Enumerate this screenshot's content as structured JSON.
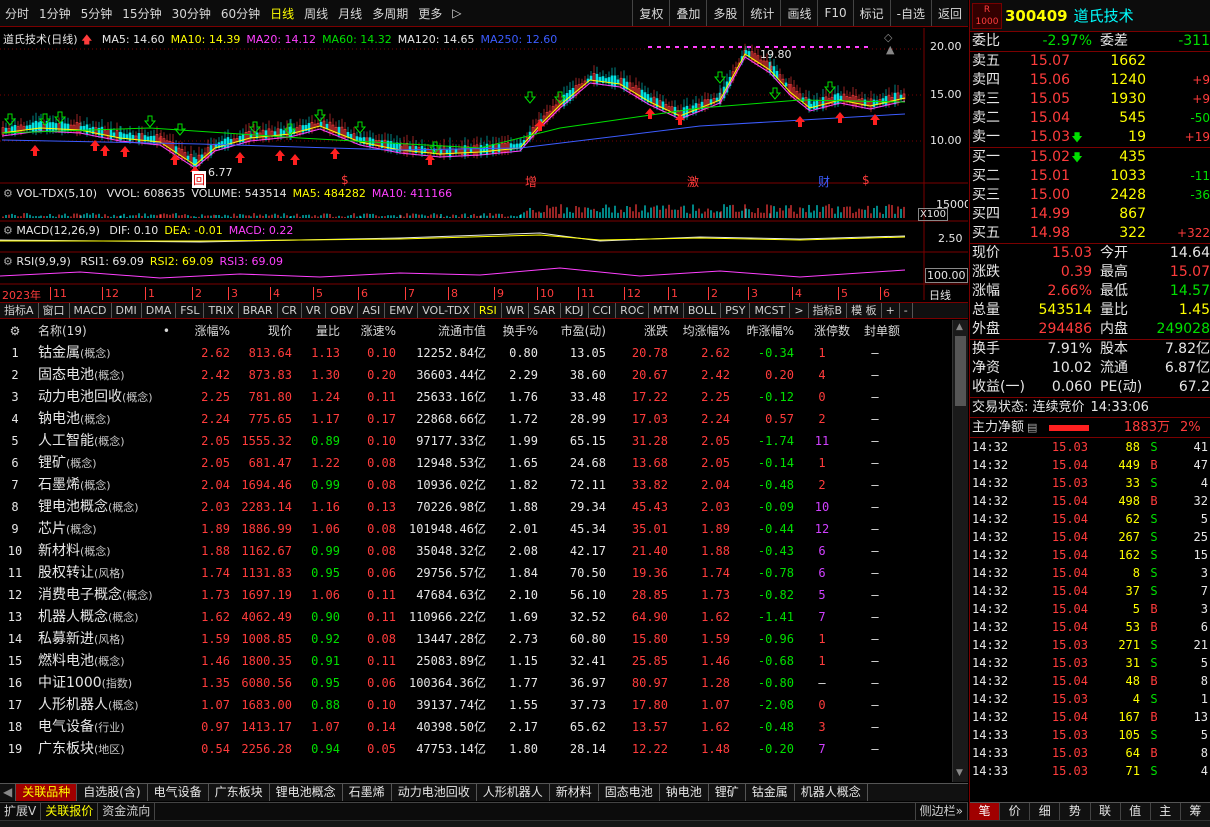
{
  "toolbar": {
    "periods": [
      "分时",
      "1分钟",
      "5分钟",
      "15分钟",
      "30分钟",
      "60分钟",
      "日线",
      "周线",
      "月线",
      "多周期",
      "更多"
    ],
    "active_period": "日线",
    "more_suffix": "▷",
    "right_buttons": [
      "复权",
      "叠加",
      "多股",
      "统计",
      "画线",
      "F10",
      "标记",
      "-自选",
      "返回"
    ]
  },
  "chart": {
    "title": "道氏技术(日线)",
    "ma_labels": [
      {
        "text": "MA5: 14.60",
        "color": "#e6e6e6"
      },
      {
        "text": "MA10: 14.39",
        "color": "#ffff00"
      },
      {
        "text": "MA20: 14.12",
        "color": "#ff40ff"
      },
      {
        "text": "MA60: 14.32",
        "color": "#00e000"
      },
      {
        "text": "MA120: 14.65",
        "color": "#e6e6e6"
      },
      {
        "text": "MA250: 12.60",
        "color": "#3c5cff"
      }
    ],
    "price_axis": [
      "20.00",
      "15.00",
      "10.00"
    ],
    "high_label": "19.80",
    "low_label": "6.77",
    "markers": [
      {
        "text": "回",
        "color": "#ff3c3c"
      },
      {
        "text": "$",
        "color": "#ff3c3c"
      },
      {
        "text": "增",
        "color": "#ff3c3c"
      },
      {
        "text": "激",
        "color": "#ff3c3c"
      },
      {
        "text": "财",
        "color": "#3c5cff"
      },
      {
        "text": "$",
        "color": "#ff3c3c"
      }
    ],
    "vol": {
      "label": "VOL-TDX(5,10)",
      "items": [
        {
          "text": "VVOL: 608635",
          "color": "#e6e6e6"
        },
        {
          "text": "VOLUME: 543514",
          "color": "#e6e6e6"
        },
        {
          "text": "MA5: 484282",
          "color": "#ffff00"
        },
        {
          "text": "MA10: 411166",
          "color": "#ff40ff"
        }
      ],
      "axis": "15000",
      "unit": "X100"
    },
    "macd": {
      "label": "MACD(12,26,9)",
      "items": [
        {
          "text": "DIF: 0.10",
          "color": "#e6e6e6"
        },
        {
          "text": "DEA: -0.01",
          "color": "#ffff00"
        },
        {
          "text": "MACD: 0.22",
          "color": "#ff40ff"
        }
      ],
      "axis": "2.50"
    },
    "rsi": {
      "label": "RSI(9,9,9)",
      "items": [
        {
          "text": "RSI1: 69.09",
          "color": "#e6e6e6"
        },
        {
          "text": "RSI2: 69.09",
          "color": "#ffff00"
        },
        {
          "text": "RSI3: 69.09",
          "color": "#ff40ff"
        }
      ],
      "axis": "100.00"
    },
    "date_axis": {
      "year": "2023年",
      "months": [
        "11",
        "12",
        "1",
        "2",
        "3",
        "4",
        "5",
        "6",
        "7",
        "8",
        "9",
        "10",
        "11",
        "12",
        "1",
        "2",
        "3",
        "4",
        "5",
        "6"
      ],
      "right_label": "日线"
    }
  },
  "indicator_tabs": [
    "指标A",
    "窗口",
    "MACD",
    "DMI",
    "DMA",
    "FSL",
    "TRIX",
    "BRAR",
    "CR",
    "VR",
    "OBV",
    "ASI",
    "EMV",
    "VOL-TDX",
    "RSI",
    "WR",
    "SAR",
    "KDJ",
    "CCI",
    "ROC",
    "MTM",
    "BOLL",
    "PSY",
    "MCST",
    ">",
    "指标B",
    "模 板",
    "+",
    "-"
  ],
  "indicator_active": "RSI",
  "table": {
    "headers": [
      "",
      "名称(19)",
      "•",
      "涨幅%",
      "现价",
      "量比",
      "涨速%",
      "流通市值",
      "换手%",
      "市盈(动)",
      "涨跌",
      "均涨幅%",
      "昨涨幅%",
      "涨停数",
      "封单额"
    ],
    "rows": [
      {
        "idx": "1",
        "name": "钴金属",
        "tag": "(概念)",
        "chg": "2.62",
        "price": "813.64",
        "vr": "1.13",
        "spd": "0.10",
        "mcap": "12252.84亿",
        "turn": "0.80",
        "pe": "13.05",
        "diff": "20.78",
        "avg": "2.62",
        "prev": "-0.34",
        "limit": "1",
        "seal": "–"
      },
      {
        "idx": "2",
        "name": "固态电池",
        "tag": "(概念)",
        "chg": "2.42",
        "price": "873.83",
        "vr": "1.30",
        "spd": "0.20",
        "mcap": "36603.44亿",
        "turn": "2.29",
        "pe": "38.60",
        "diff": "20.67",
        "avg": "2.42",
        "prev": "0.20",
        "limit": "4",
        "seal": "–"
      },
      {
        "idx": "3",
        "name": "动力电池回收",
        "tag": "(概念)",
        "chg": "2.25",
        "price": "781.80",
        "vr": "1.24",
        "spd": "0.11",
        "mcap": "25633.16亿",
        "turn": "1.76",
        "pe": "33.48",
        "diff": "17.22",
        "avg": "2.25",
        "prev": "-0.12",
        "limit": "0",
        "seal": "–"
      },
      {
        "idx": "4",
        "name": "钠电池",
        "tag": "(概念)",
        "chg": "2.24",
        "price": "775.65",
        "vr": "1.17",
        "spd": "0.17",
        "mcap": "22868.66亿",
        "turn": "1.72",
        "pe": "28.99",
        "diff": "17.03",
        "avg": "2.24",
        "prev": "0.57",
        "limit": "2",
        "seal": "–"
      },
      {
        "idx": "5",
        "name": "人工智能",
        "tag": "(概念)",
        "chg": "2.05",
        "price": "1555.32",
        "vr": "0.89",
        "spd": "0.10",
        "mcap": "97177.33亿",
        "turn": "1.99",
        "pe": "65.15",
        "diff": "31.28",
        "avg": "2.05",
        "prev": "-1.74",
        "limit": "11",
        "seal": "–"
      },
      {
        "idx": "6",
        "name": "锂矿",
        "tag": "(概念)",
        "chg": "2.05",
        "price": "681.47",
        "vr": "1.22",
        "spd": "0.08",
        "mcap": "12948.53亿",
        "turn": "1.65",
        "pe": "24.68",
        "diff": "13.68",
        "avg": "2.05",
        "prev": "-0.14",
        "limit": "1",
        "seal": "–"
      },
      {
        "idx": "7",
        "name": "石墨烯",
        "tag": "(概念)",
        "chg": "2.04",
        "price": "1694.46",
        "vr": "0.99",
        "spd": "0.08",
        "mcap": "10936.02亿",
        "turn": "1.82",
        "pe": "72.11",
        "diff": "33.82",
        "avg": "2.04",
        "prev": "-0.48",
        "limit": "2",
        "seal": "–"
      },
      {
        "idx": "8",
        "name": "锂电池概念",
        "tag": "(概念)",
        "chg": "2.03",
        "price": "2283.14",
        "vr": "1.16",
        "spd": "0.13",
        "mcap": "70226.98亿",
        "turn": "1.88",
        "pe": "29.34",
        "diff": "45.43",
        "avg": "2.03",
        "prev": "-0.09",
        "limit": "10",
        "seal": "–"
      },
      {
        "idx": "9",
        "name": "芯片",
        "tag": "(概念)",
        "chg": "1.89",
        "price": "1886.99",
        "vr": "1.06",
        "spd": "0.08",
        "mcap": "101948.46亿",
        "turn": "2.01",
        "pe": "45.34",
        "diff": "35.01",
        "avg": "1.89",
        "prev": "-0.44",
        "limit": "12",
        "seal": "–"
      },
      {
        "idx": "10",
        "name": "新材料",
        "tag": "(概念)",
        "chg": "1.88",
        "price": "1162.67",
        "vr": "0.99",
        "spd": "0.08",
        "mcap": "35048.32亿",
        "turn": "2.08",
        "pe": "42.17",
        "diff": "21.40",
        "avg": "1.88",
        "prev": "-0.43",
        "limit": "6",
        "seal": "–"
      },
      {
        "idx": "11",
        "name": "股权转让",
        "tag": "(风格)",
        "chg": "1.74",
        "price": "1131.83",
        "vr": "0.95",
        "spd": "0.06",
        "mcap": "29756.57亿",
        "turn": "1.84",
        "pe": "70.50",
        "diff": "19.36",
        "avg": "1.74",
        "prev": "-0.78",
        "limit": "6",
        "seal": "–"
      },
      {
        "idx": "12",
        "name": "消费电子概念",
        "tag": "(概念)",
        "chg": "1.73",
        "price": "1697.19",
        "vr": "1.06",
        "spd": "0.11",
        "mcap": "47684.63亿",
        "turn": "2.10",
        "pe": "56.10",
        "diff": "28.85",
        "avg": "1.73",
        "prev": "-0.82",
        "limit": "5",
        "seal": "–"
      },
      {
        "idx": "13",
        "name": "机器人概念",
        "tag": "(概念)",
        "chg": "1.62",
        "price": "4062.49",
        "vr": "0.90",
        "spd": "0.11",
        "mcap": "110966.22亿",
        "turn": "1.69",
        "pe": "32.52",
        "diff": "64.90",
        "avg": "1.62",
        "prev": "-1.41",
        "limit": "7",
        "seal": "–"
      },
      {
        "idx": "14",
        "name": "私募新进",
        "tag": "(风格)",
        "chg": "1.59",
        "price": "1008.85",
        "vr": "0.92",
        "spd": "0.08",
        "mcap": "13447.28亿",
        "turn": "2.73",
        "pe": "60.80",
        "diff": "15.80",
        "avg": "1.59",
        "prev": "-0.96",
        "limit": "1",
        "seal": "–"
      },
      {
        "idx": "15",
        "name": "燃料电池",
        "tag": "(概念)",
        "chg": "1.46",
        "price": "1800.35",
        "vr": "0.91",
        "spd": "0.11",
        "mcap": "25083.89亿",
        "turn": "1.15",
        "pe": "32.41",
        "diff": "25.85",
        "avg": "1.46",
        "prev": "-0.68",
        "limit": "1",
        "seal": "–"
      },
      {
        "idx": "16",
        "name": "中证1000",
        "tag": "(指数)",
        "chg": "1.35",
        "price": "6080.56",
        "vr": "0.95",
        "spd": "0.06",
        "mcap": "100364.36亿",
        "turn": "1.77",
        "pe": "36.97",
        "diff": "80.97",
        "avg": "1.28",
        "prev": "-0.80",
        "limit": "–",
        "seal": "–"
      },
      {
        "idx": "17",
        "name": "人形机器人",
        "tag": "(概念)",
        "chg": "1.07",
        "price": "1683.00",
        "vr": "0.88",
        "spd": "0.10",
        "mcap": "39137.74亿",
        "turn": "1.55",
        "pe": "37.73",
        "diff": "17.80",
        "avg": "1.07",
        "prev": "-2.08",
        "limit": "0",
        "seal": "–"
      },
      {
        "idx": "18",
        "name": "电气设备",
        "tag": "(行业)",
        "chg": "0.97",
        "price": "1413.17",
        "vr": "1.07",
        "spd": "0.14",
        "mcap": "40398.50亿",
        "turn": "2.17",
        "pe": "65.62",
        "diff": "13.57",
        "avg": "1.62",
        "prev": "-0.48",
        "limit": "3",
        "seal": "–"
      },
      {
        "idx": "19",
        "name": "广东板块",
        "tag": "(地区)",
        "chg": "0.54",
        "price": "2256.28",
        "vr": "0.94",
        "spd": "0.05",
        "mcap": "47753.14亿",
        "turn": "1.80",
        "pe": "28.14",
        "diff": "12.22",
        "avg": "1.48",
        "prev": "-0.20",
        "limit": "7",
        "seal": "–"
      }
    ]
  },
  "bottom_tabs": [
    "关联品种",
    "自选股(含)",
    "电气设备",
    "广东板块",
    "锂电池概念",
    "石墨烯",
    "动力电池回收",
    "人形机器人",
    "新材料",
    "固态电池",
    "钠电池",
    "锂矿",
    "钴金属",
    "机器人概念"
  ],
  "bottom_bar": [
    "扩展V",
    "关联报价",
    "资金流向"
  ],
  "bottom_right": "侧边栏»",
  "quote": {
    "badge": "R 1000",
    "code": "300409",
    "name": "道氏技术",
    "weibi_label": "委比",
    "weibi": "-2.97%",
    "weicha_label": "委差",
    "weicha": "-311",
    "sells": [
      {
        "label": "卖五",
        "price": "15.07",
        "vol": "1662",
        "delta": ""
      },
      {
        "label": "卖四",
        "price": "15.06",
        "vol": "1240",
        "delta": "+9"
      },
      {
        "label": "卖三",
        "price": "15.05",
        "vol": "1930",
        "delta": "+9"
      },
      {
        "label": "卖二",
        "price": "15.04",
        "vol": "545",
        "delta": "-50"
      },
      {
        "label": "卖一",
        "price": "15.03",
        "vol": "19",
        "delta": "+19"
      }
    ],
    "buys": [
      {
        "label": "买一",
        "price": "15.02",
        "vol": "435",
        "delta": ""
      },
      {
        "label": "买二",
        "price": "15.01",
        "vol": "1033",
        "delta": "-11"
      },
      {
        "label": "买三",
        "price": "15.00",
        "vol": "2428",
        "delta": "-36"
      },
      {
        "label": "买四",
        "price": "14.99",
        "vol": "867",
        "delta": ""
      },
      {
        "label": "买五",
        "price": "14.98",
        "vol": "322",
        "delta": "+322"
      }
    ],
    "stats": [
      {
        "l1": "现价",
        "v1": "15.03",
        "c1": "#ff3c3c",
        "l2": "今开",
        "v2": "14.64",
        "c2": "#e6e6e6"
      },
      {
        "l1": "涨跌",
        "v1": "0.39",
        "c1": "#ff3c3c",
        "l2": "最高",
        "v2": "15.07",
        "c2": "#ff3c3c"
      },
      {
        "l1": "涨幅",
        "v1": "2.66%",
        "c1": "#ff3c3c",
        "l2": "最低",
        "v2": "14.57",
        "c2": "#00e000"
      },
      {
        "l1": "总量",
        "v1": "543514",
        "c1": "#ffff00",
        "l2": "量比",
        "v2": "1.45",
        "c2": "#ffff00"
      },
      {
        "l1": "外盘",
        "v1": "294486",
        "c1": "#ff3c3c",
        "l2": "内盘",
        "v2": "249028",
        "c2": "#00e000"
      }
    ],
    "stats2": [
      {
        "l1": "换手",
        "v1": "7.91%",
        "l2": "股本",
        "v2": "7.82亿"
      },
      {
        "l1": "净资",
        "v1": "10.02",
        "l2": "流通",
        "v2": "6.87亿"
      },
      {
        "l1": "收益(一)",
        "v1": "0.060",
        "l2": "PE(动)",
        "v2": "67.2"
      }
    ],
    "trade_status": "交易状态: 连续竞价",
    "trade_time": "14:33:06",
    "main_flow_label": "主力净额",
    "main_flow": "1883万",
    "main_flow_pct": "2%"
  },
  "ticks": [
    {
      "t": "14:32",
      "p": "15.03",
      "v": "88",
      "s": "S",
      "n": "41"
    },
    {
      "t": "14:32",
      "p": "15.04",
      "v": "449",
      "s": "B",
      "n": "47"
    },
    {
      "t": "14:32",
      "p": "15.03",
      "v": "33",
      "s": "S",
      "n": "4"
    },
    {
      "t": "14:32",
      "p": "15.04",
      "v": "498",
      "s": "B",
      "n": "32"
    },
    {
      "t": "14:32",
      "p": "15.04",
      "v": "62",
      "s": "S",
      "n": "5"
    },
    {
      "t": "14:32",
      "p": "15.04",
      "v": "267",
      "s": "S",
      "n": "25"
    },
    {
      "t": "14:32",
      "p": "15.04",
      "v": "162",
      "s": "S",
      "n": "15"
    },
    {
      "t": "14:32",
      "p": "15.04",
      "v": "8",
      "s": "S",
      "n": "3"
    },
    {
      "t": "14:32",
      "p": "15.04",
      "v": "37",
      "s": "S",
      "n": "7"
    },
    {
      "t": "14:32",
      "p": "15.04",
      "v": "5",
      "s": "B",
      "n": "3"
    },
    {
      "t": "14:32",
      "p": "15.04",
      "v": "53",
      "s": "B",
      "n": "6"
    },
    {
      "t": "14:32",
      "p": "15.03",
      "v": "271",
      "s": "S",
      "n": "21"
    },
    {
      "t": "14:32",
      "p": "15.03",
      "v": "31",
      "s": "S",
      "n": "5"
    },
    {
      "t": "14:32",
      "p": "15.04",
      "v": "48",
      "s": "B",
      "n": "8"
    },
    {
      "t": "14:32",
      "p": "15.03",
      "v": "4",
      "s": "S",
      "n": "1"
    },
    {
      "t": "14:32",
      "p": "15.04",
      "v": "167",
      "s": "B",
      "n": "13"
    },
    {
      "t": "14:33",
      "p": "15.03",
      "v": "105",
      "s": "S",
      "n": "5"
    },
    {
      "t": "14:33",
      "p": "15.03",
      "v": "64",
      "s": "B",
      "n": "8"
    },
    {
      "t": "14:33",
      "p": "15.03",
      "v": "71",
      "s": "S",
      "n": "4"
    }
  ],
  "right_tabs": [
    "笔",
    "价",
    "细",
    "势",
    "联",
    "值",
    "主",
    "筹"
  ],
  "right_tab_active": "笔"
}
